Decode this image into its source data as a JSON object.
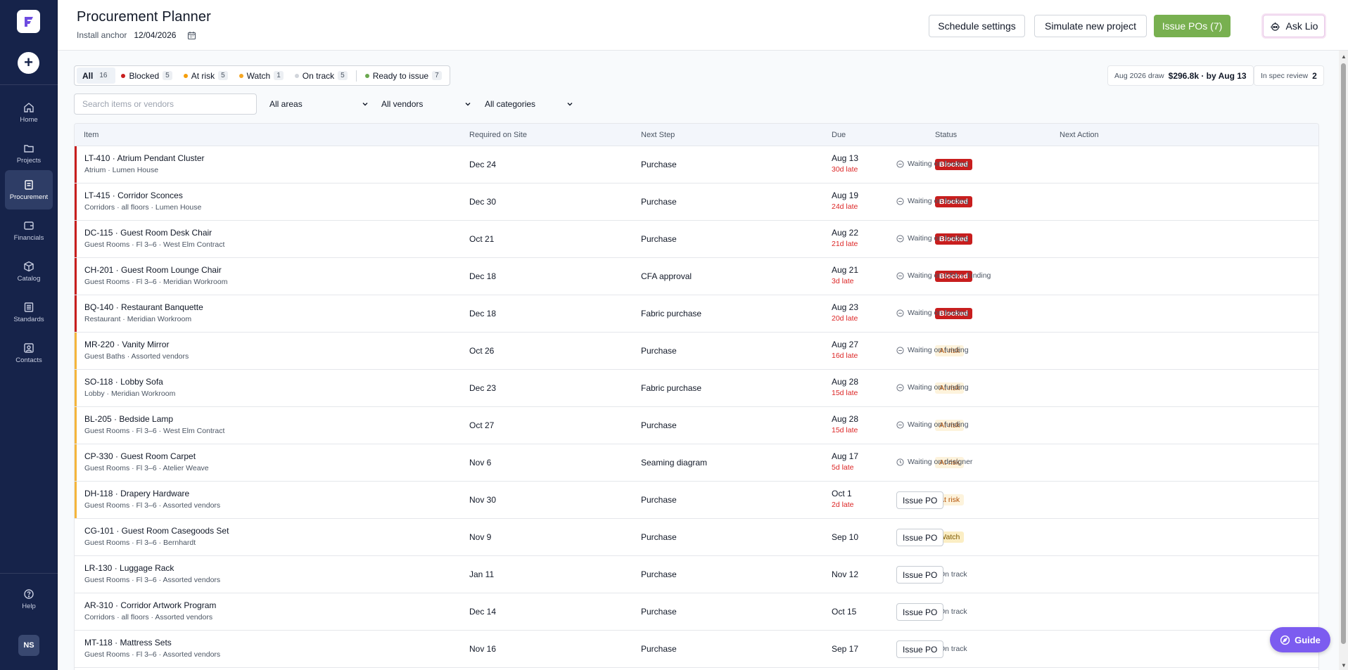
{
  "app": {
    "title": "Procurement Planner"
  },
  "sidebar": {
    "items": [
      {
        "label": "Home",
        "icon": "home-icon"
      },
      {
        "label": "Projects",
        "icon": "folder-icon"
      },
      {
        "label": "Procurement",
        "icon": "document-icon",
        "active": true
      },
      {
        "label": "Financials",
        "icon": "wallet-icon"
      },
      {
        "label": "Catalog",
        "icon": "cube-icon"
      },
      {
        "label": "Standards",
        "icon": "list-icon"
      },
      {
        "label": "Contacts",
        "icon": "contacts-icon"
      }
    ],
    "help_label": "Help",
    "avatar_initials": "NS"
  },
  "header": {
    "install_anchor_label": "Install anchor",
    "install_anchor_date": "12/04/2026",
    "schedule_settings": "Schedule settings",
    "simulate_project": "Simulate new project",
    "issue_pos": "Issue POs (7)",
    "ask_lio": "Ask Lio"
  },
  "filters": {
    "chips": [
      {
        "label": "All",
        "count": "16",
        "color": ""
      },
      {
        "label": "Blocked",
        "count": "5",
        "color": "#c81e1e"
      },
      {
        "label": "At risk",
        "count": "5",
        "color": "#f59e0b"
      },
      {
        "label": "Watch",
        "count": "1",
        "color": "#f59e0b"
      },
      {
        "label": "On track",
        "count": "5",
        "color": "#d1d5db"
      },
      {
        "label": "Ready to issue",
        "count": "7",
        "color": "#6aa84f"
      }
    ],
    "search_placeholder": "Search items or vendors",
    "areas": "All areas",
    "vendors": "All vendors",
    "categories": "All categories"
  },
  "stats": {
    "draw_label": "Aug 2026 draw",
    "draw_value": "$296.8k · by Aug 13",
    "spec_label": "In spec review",
    "spec_value": "2"
  },
  "colors": {
    "sidebar_bg": "#16234a",
    "primary_green": "#78b050",
    "blocked_red": "#c81e1e",
    "at_risk_amber": "#f5b53b",
    "guide_purple": "#7c5cf0"
  },
  "table": {
    "columns": [
      "Item",
      "Required on Site",
      "Next Step",
      "Due",
      "Status",
      "Next Action"
    ],
    "rows": [
      {
        "name": "LT-410 · Atrium Pendant Cluster",
        "sub": "Atrium · Lumen House",
        "required": "Dec 24",
        "step": "Purchase",
        "due": "Aug 13",
        "late": "30d late",
        "status": "Blocked",
        "action": "Waiting on funding",
        "action_type": "text"
      },
      {
        "name": "LT-415 · Corridor Sconces",
        "sub": "Corridors · all floors · Lumen House",
        "required": "Dec 30",
        "step": "Purchase",
        "due": "Aug 19",
        "late": "24d late",
        "status": "Blocked",
        "action": "Waiting on funding",
        "action_type": "text"
      },
      {
        "name": "DC-115 · Guest Room Desk Chair",
        "sub": "Guest Rooms · Fl 3–6 · West Elm Contract",
        "required": "Oct 21",
        "step": "Purchase",
        "due": "Aug 22",
        "late": "21d late",
        "status": "Blocked",
        "action": "Waiting on funding",
        "action_type": "text"
      },
      {
        "name": "CH-201 · Guest Room Lounge Chair",
        "sub": "Guest Rooms · Fl 3–6 · Meridian Workroom",
        "required": "Dec 18",
        "step": "CFA approval",
        "due": "Aug 21",
        "late": "3d late",
        "status": "Blocked",
        "action": "Waiting on CFA + funding",
        "action_type": "text"
      },
      {
        "name": "BQ-140 · Restaurant Banquette",
        "sub": "Restaurant · Meridian Workroom",
        "required": "Dec 18",
        "step": "Fabric purchase",
        "due": "Aug 23",
        "late": "20d late",
        "status": "Blocked",
        "action": "Waiting on funding",
        "action_type": "text"
      },
      {
        "name": "MR-220 · Vanity Mirror",
        "sub": "Guest Baths · Assorted vendors",
        "required": "Oct 26",
        "step": "Purchase",
        "due": "Aug 27",
        "late": "16d late",
        "status": "At risk",
        "action": "Waiting on funding",
        "action_type": "text"
      },
      {
        "name": "SO-118 · Lobby Sofa",
        "sub": "Lobby · Meridian Workroom",
        "required": "Dec 23",
        "step": "Fabric purchase",
        "due": "Aug 28",
        "late": "15d late",
        "status": "At risk",
        "action": "Waiting on funding",
        "action_type": "text"
      },
      {
        "name": "BL-205 · Bedside Lamp",
        "sub": "Guest Rooms · Fl 3–6 · West Elm Contract",
        "required": "Oct 27",
        "step": "Purchase",
        "due": "Aug 28",
        "late": "15d late",
        "status": "At risk",
        "action": "Waiting on funding",
        "action_type": "text"
      },
      {
        "name": "CP-330 · Guest Room Carpet",
        "sub": "Guest Rooms · Fl 3–6 · Atelier Weave",
        "required": "Nov 6",
        "step": "Seaming diagram",
        "due": "Aug 17",
        "late": "5d late",
        "status": "At risk",
        "action": "Waiting on designer",
        "action_type": "clock"
      },
      {
        "name": "DH-118 · Drapery Hardware",
        "sub": "Guest Rooms · Fl 3–6 · Assorted vendors",
        "required": "Nov 30",
        "step": "Purchase",
        "due": "Oct 1",
        "late": "2d late",
        "status": "At risk",
        "action": "Issue PO",
        "action_type": "button"
      },
      {
        "name": "CG-101 · Guest Room Casegoods Set",
        "sub": "Guest Rooms · Fl 3–6 · Bernhardt",
        "required": "Nov 9",
        "step": "Purchase",
        "due": "Sep 10",
        "late": "",
        "status": "Watch",
        "action": "Issue PO",
        "action_type": "button"
      },
      {
        "name": "LR-130 · Luggage Rack",
        "sub": "Guest Rooms · Fl 3–6 · Assorted vendors",
        "required": "Jan 11",
        "step": "Purchase",
        "due": "Nov 12",
        "late": "",
        "status": "On track",
        "action": "Issue PO",
        "action_type": "button"
      },
      {
        "name": "AR-310 · Corridor Artwork Program",
        "sub": "Corridors · all floors · Assorted vendors",
        "required": "Dec 14",
        "step": "Purchase",
        "due": "Oct 15",
        "late": "",
        "status": "On track",
        "action": "Issue PO",
        "action_type": "button"
      },
      {
        "name": "MT-118 · Mattress Sets",
        "sub": "Guest Rooms · Fl 3–6 · Assorted vendors",
        "required": "Nov 16",
        "step": "Purchase",
        "due": "Sep 17",
        "late": "",
        "status": "On track",
        "action": "Issue PO",
        "action_type": "button"
      }
    ]
  },
  "guide": {
    "label": "Guide"
  }
}
